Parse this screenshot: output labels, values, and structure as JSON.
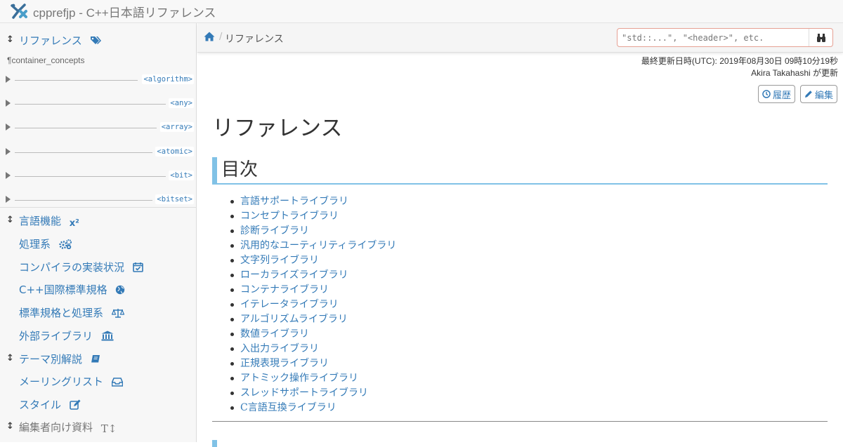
{
  "site": {
    "title": "cpprefjp - C++日本語リファレンス"
  },
  "sidebar": {
    "top": {
      "label": "リファレンス"
    },
    "sub": "¶container_concepts",
    "headers": [
      {
        "tag": "<algorithm>"
      },
      {
        "tag": "<any>"
      },
      {
        "tag": "<array>"
      },
      {
        "tag": "<atomic>"
      },
      {
        "tag": "<bit>"
      },
      {
        "tag": "<bitset>"
      }
    ],
    "items": [
      {
        "label": "言語機能",
        "icon": "superscript-icon"
      },
      {
        "label": "処理系",
        "icon": "gears-icon"
      },
      {
        "label": "コンパイラの実装状況",
        "icon": "calendar-check-icon"
      },
      {
        "label": "C++国際標準規格",
        "icon": "globe-icon"
      },
      {
        "label": "標準規格と処理系",
        "icon": "balance-scale-icon"
      },
      {
        "label": "外部ライブラリ",
        "icon": "bank-icon"
      },
      {
        "label": "テーマ別解説",
        "icon": "book-icon"
      },
      {
        "label": "メーリングリスト",
        "icon": "inbox-icon"
      },
      {
        "label": "スタイル",
        "icon": "edit-icon"
      },
      {
        "label": "編集者向け資料",
        "icon": "text-height-icon"
      }
    ]
  },
  "breadcrumb": {
    "current": "リファレンス",
    "sep": "/"
  },
  "search": {
    "placeholder": "\"std::...\", \"<header>\", etc."
  },
  "meta": {
    "updated": "最終更新日時(UTC): 2019年08月30日 09時10分19秒",
    "author": "Akira Takahashi が更新"
  },
  "buttons": {
    "history": "履歴",
    "edit": "編集"
  },
  "page": {
    "title": "リファレンス",
    "toc_title": "目次",
    "toc": [
      "言語サポートライブラリ",
      "コンセプトライブラリ",
      "診断ライブラリ",
      "汎用的なユーティリティライブラリ",
      "文字列ライブラリ",
      "ローカライズライブラリ",
      "コンテナライブラリ",
      "イテレータライブラリ",
      "アルゴリズムライブラリ",
      "数値ライブラリ",
      "入出力ライブラリ",
      "正規表現ライブラリ",
      "アトミック操作ライブラリ",
      "スレッドサポートライブラリ",
      "C言語互換ライブラリ"
    ]
  },
  "colors": {
    "link": "#337ab7",
    "accent": "#81c2e6",
    "search_border": "#e6a194"
  }
}
